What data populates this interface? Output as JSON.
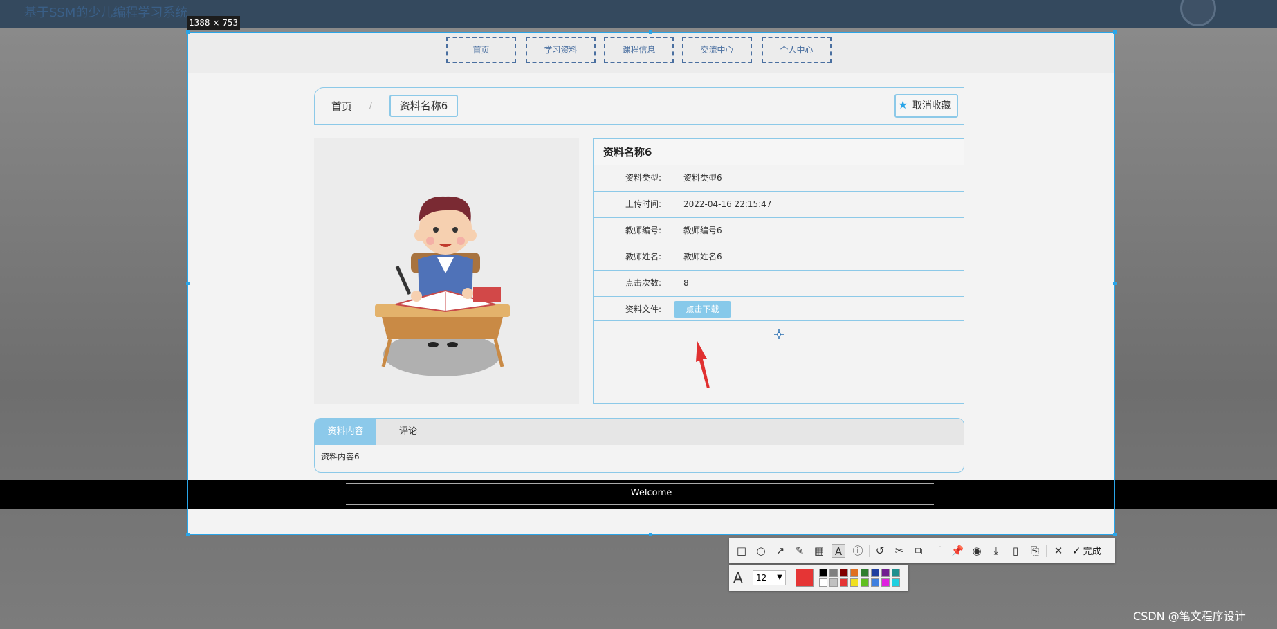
{
  "app": {
    "title": "基于SSM的少儿编程学习系统"
  },
  "capture": {
    "size_label": "1388 × 753"
  },
  "nav": {
    "items": [
      "首页",
      "学习资料",
      "课程信息",
      "交流中心",
      "个人中心"
    ]
  },
  "breadcrumb": {
    "home": "首页",
    "separator": "/",
    "current": "资料名称6"
  },
  "actions": {
    "unfavorite_label": "取消收藏"
  },
  "detail": {
    "title": "资料名称6",
    "rows": [
      {
        "label": "资料类型:",
        "value": "资料类型6"
      },
      {
        "label": "上传时间:",
        "value": "2022-04-16 22:15:47"
      },
      {
        "label": "教师编号:",
        "value": "教师编号6"
      },
      {
        "label": "教师姓名:",
        "value": "教师姓名6"
      },
      {
        "label": "点击次数:",
        "value": "8"
      }
    ],
    "file_label": "资料文件:",
    "download_label": "点击下载"
  },
  "tabs": {
    "items": [
      "资料内容",
      "评论"
    ],
    "content": "资料内容6"
  },
  "footer": {
    "text": "Welcome"
  },
  "toolbar": {
    "done_label": "完成",
    "font_size": "12",
    "current_color": "#e53535",
    "palette_top": [
      "#000000",
      "#808080",
      "#800000",
      "#e07020",
      "#2f7d2f",
      "#1f3f9f",
      "#701f8f",
      "#1f8f8f"
    ],
    "palette_bottom": [
      "#ffffff",
      "#c0c0c0",
      "#e53535",
      "#f0e020",
      "#60c020",
      "#3f7fdf",
      "#df20df",
      "#20d0e0"
    ]
  },
  "watermark": "CSDN @笔文程序设计"
}
